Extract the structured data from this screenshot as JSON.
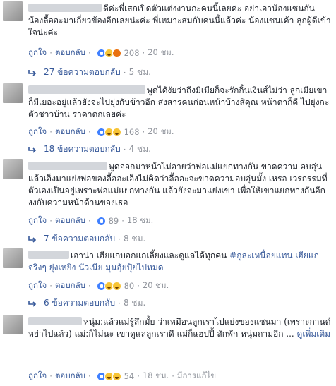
{
  "actions": {
    "like": "ถูกใจ",
    "reply": "ตอบกลับ",
    "separator": "·"
  },
  "comments": [
    {
      "text": "ดีค่ะพี่เสกเปิดตัวแต่งงานกะคนนี้เลยค่ะ อย่าเอาน้องแซนกัน น้องลื้ออะมาเกี่ยวข้องอีกเลยน่ะค่ะ พี่เหมาะสมกับคนนี้แล้วค่ะ น้องแซนเค้า ลูกผู้ดีเข้าใจน่ะค่ะ",
      "reactions": [
        "like",
        "haha",
        "angry"
      ],
      "count": "208",
      "time": "20 ชม.",
      "replies": "27 ข้อความตอบกลับ",
      "replies_time": "5 ชม."
    },
    {
      "text": "พูดได้งัยว่าถึงมีเมียก็จะรักกิ้นเงินส์ไม่ว่า ลูกเมียเขาก็มีเยอะอยู่แล้วยังจะไปยุ่งกับข้าวอีก สงสารคนก่อนหน้าบ้างสิคุณ หน้าตาก็ดี ไปยุ่งกะตัวชาวบ้าน ราคาตกเลยค่ะ",
      "reactions": [
        "like",
        "haha",
        "sad"
      ],
      "count": "168",
      "time": "20 ชม.",
      "replies": "18 ข้อความตอบกลับ",
      "replies_time": "4 ชม."
    },
    {
      "text": "พูดออกมาหน้าไม่อายว่าพ่อแม่แยกทางกัน ขาดความ อบอุ่น แล้วเอ็งมาแย่งพ่อของลื้ออะเอ็งไม่คิดว่าลื้ออะจะขาดความอบอุ่นมั้ง เหรอ เวรกรรมที่ตัวเองเป็นอยู่เพราะพ่อแม่แยกทางกัน แล้วยังจะมาแย่งเขา เพื่อให้เขาแยกทางกันอีก งงกับความหน้าด้านของเธอ",
      "reactions": [
        "like"
      ],
      "count": "89",
      "time": "18 ชม.",
      "replies": "7 ข้อความตอบกลับ",
      "replies_time": "8 ชม."
    },
    {
      "text": "เอาน่า เฮียแกบอกแกเลี้ยงและดูแลได้ทุกคน",
      "hashtag": "#กูละเหนื่อยแทน",
      "text2": "เฮียแกจริงๆ ยุ่งเหยิง นัวเนีย มุนอุ้ยปุ้ยไปหมด",
      "reactions": [
        "like",
        "haha",
        "sad"
      ],
      "count": "80",
      "time": "20 ชม.",
      "replies": "6 ข้อความตอบกลับ",
      "replies_time": "8 ชม."
    },
    {
      "text": "หนุ่ม:แล้วแม่รู้สึกมั้ย ว่าเหมือนลูกเราไปแย่งของแซนมา (เพราะกานต์หย่าไปแล้ว) แม่:ก็ไม่นะ เขาดูแลลูกเราดี แม่ก็แฮปปี้ สักพัก หนุ่มถามอีก ...",
      "see_more": "ดูเพิ่มเติม",
      "reactions": [
        "like",
        "haha",
        "sad"
      ],
      "count": "54",
      "time": "18 ชม.",
      "edited": "มีการแก้ไข"
    }
  ],
  "colors": {
    "link": "#365899",
    "meta": "#90949c",
    "text": "#1d2129"
  }
}
